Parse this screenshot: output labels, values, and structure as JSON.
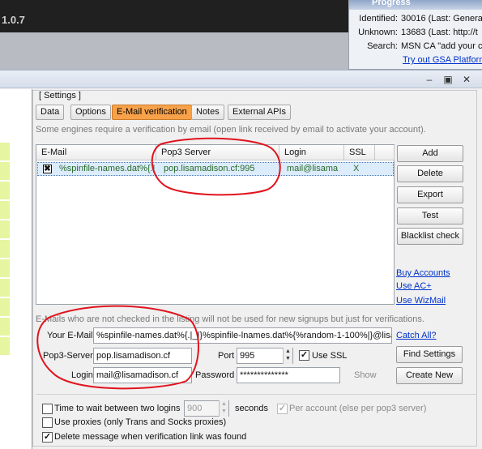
{
  "background_app": {
    "title": "1.0.7"
  },
  "progress_panel": {
    "title": "Progress",
    "rows": [
      {
        "label": "Identified:",
        "value": "30016 (Last: Genera"
      },
      {
        "label": "Unknown:",
        "value": "13683 (Last: http://t"
      },
      {
        "label": "Search:",
        "value": "MSN CA \"add your c"
      }
    ],
    "link": "Try out GSA Platform"
  },
  "dialog": {
    "group_caption": "[ Settings ]",
    "tabs": [
      {
        "label": "Data",
        "active": false
      },
      {
        "label": "Options",
        "active": false
      },
      {
        "label": "E-Mail verification",
        "active": true
      },
      {
        "label": "Notes",
        "active": false
      },
      {
        "label": "External APIs",
        "active": false
      }
    ],
    "hint": "Some engines require a verification by email (open link received by email to activate your account).",
    "grid": {
      "columns": [
        "E-Mail",
        "Pop3 Server",
        "Login",
        "SSL"
      ],
      "row": {
        "checked": true,
        "email": "%spinfile-names.dat%{.|",
        "pop3": "pop.lisamadison.cf:995",
        "login": "mail@lisama",
        "ssl": "X"
      }
    },
    "buttons": {
      "add": "Add",
      "delete": "Delete",
      "export": "Export",
      "test": "Test",
      "blacklist": "Blacklist check",
      "find_settings": "Find Settings",
      "create_new": "Create New"
    },
    "links": {
      "buy_accounts": "Buy Accounts",
      "use_ac": "Use AC+",
      "use_wizmail": "Use WizMail",
      "catch_all": "Catch All?"
    },
    "note": "E-Mails who are not checked in the listing will not be used for new signups but just for verifications.",
    "form": {
      "your_email_label": "Your E-Mail",
      "your_email_value": "%spinfile-names.dat%{.|_|}%spinfile-lnames.dat%{%random-1-100%|}@lisamad",
      "pop3_label": "Pop3-Server",
      "pop3_value": "pop.lisamadison.cf",
      "port_label": "Port",
      "port_value": "995",
      "ssl_label": "Use SSL",
      "ssl_checked": true,
      "login_label": "Login",
      "login_value": "mail@lisamadison.cf",
      "password_label": "Password",
      "password_value": "**************",
      "show_label": "Show"
    },
    "options": {
      "time_wait_label": "Time to wait between two logins",
      "time_wait_checked": false,
      "time_wait_value": "900",
      "seconds_label": "seconds",
      "per_account_label": "Per account (else per pop3 server)",
      "per_account_checked": true,
      "use_proxies_label": "Use proxies (only Trans and Socks proxies)",
      "use_proxies_checked": false,
      "delete_message_label": "Delete message when verification link was found",
      "delete_message_checked": true
    }
  },
  "colors": {
    "active_tab": "#f7a24a",
    "annotation": "#e0141e",
    "link": "#0033cc"
  }
}
